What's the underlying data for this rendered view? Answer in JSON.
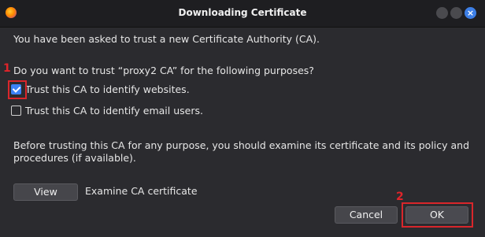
{
  "window": {
    "title": "Downloading Certificate"
  },
  "dialog": {
    "intro": "You have been asked to trust a new Certificate Authority (CA).",
    "question": "Do you want to trust “proxy2 CA” for the following purposes?",
    "options": [
      {
        "label": "Trust this CA to identify websites.",
        "checked": true
      },
      {
        "label": "Trust this CA to identify email users.",
        "checked": false
      }
    ],
    "advice": [
      "Before trusting this CA for any purpose, you should examine its certificate and its policy and",
      "procedures (if available)."
    ],
    "view_button": "View",
    "view_description": "Examine CA certificate",
    "cancel_button": "Cancel",
    "ok_button": "OK"
  },
  "annotations": {
    "marker_1": "1",
    "marker_2": "2",
    "color": "#d9262b"
  },
  "colors": {
    "accent": "#3b82f6",
    "close_button": "#3d7fe6"
  },
  "icons": {
    "app": "firefox-icon",
    "close": "close-icon"
  }
}
